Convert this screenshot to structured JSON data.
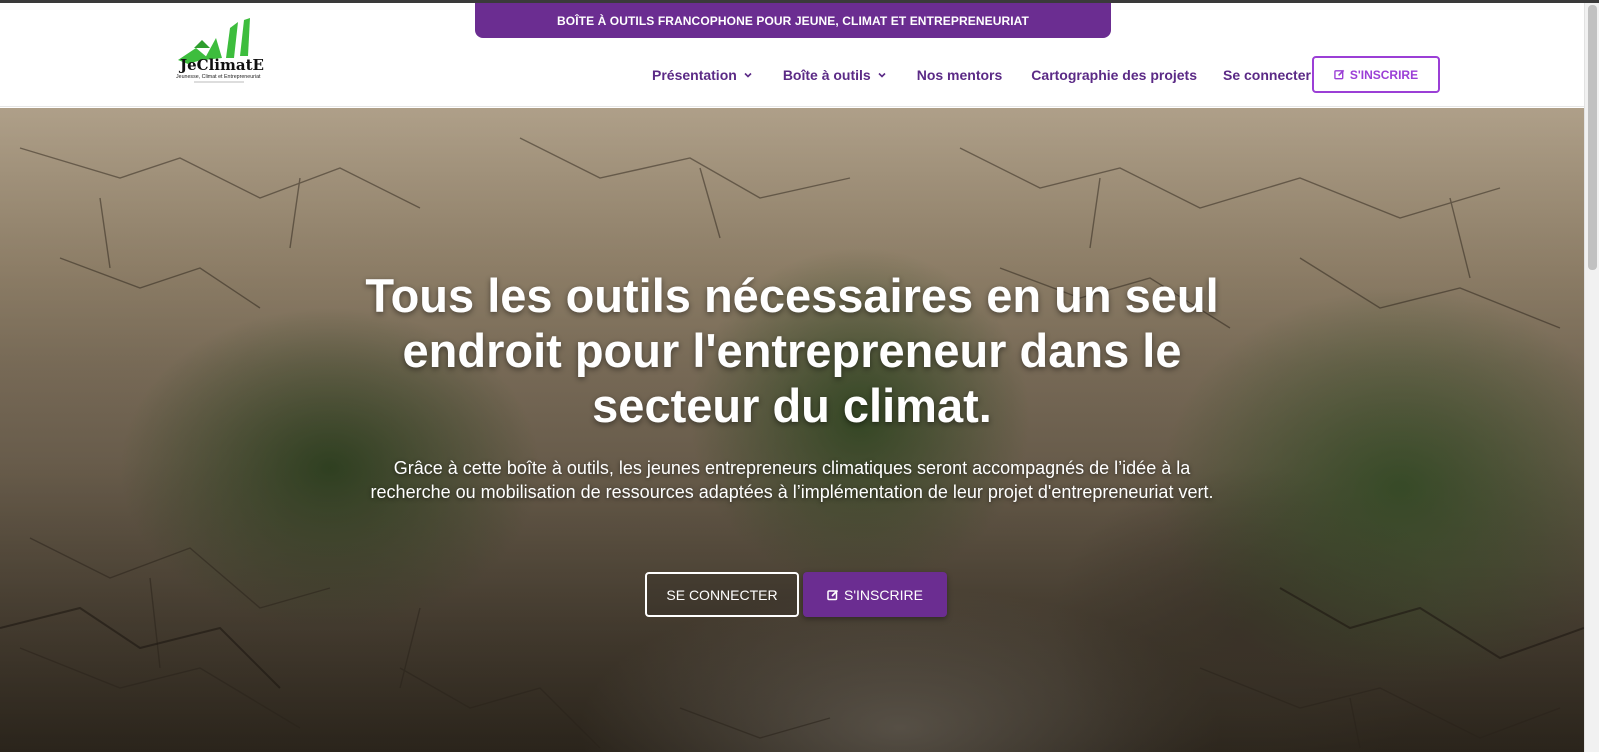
{
  "header": {
    "banner_text": "BOÎTE À OUTILS FRANCOPHONE POUR JEUNE, CLIMAT ET ENTREPRENEURIAT",
    "logo": {
      "name": "JeClimatE",
      "tagline": "Jeunesse, Climat et Entrepreneuriat"
    },
    "nav": [
      {
        "label": "Présentation",
        "has_dropdown": true
      },
      {
        "label": "Boîte à outils",
        "has_dropdown": true
      },
      {
        "label": "Nos mentors",
        "has_dropdown": false
      },
      {
        "label": "Cartographie des projets",
        "has_dropdown": false
      },
      {
        "label": "Se connecter",
        "has_dropdown": false
      }
    ],
    "signup_label": "S'INSCRIRE"
  },
  "hero": {
    "title": "Tous les outils nécessaires en un seul endroit pour l'entrepreneur dans le secteur du climat.",
    "subtitle": "Grâce à cette boîte à outils, les jeunes entrepreneurs climatiques seront accompagnés de l’idée à la recherche ou mobilisation de ressources adaptées à l’implémentation de leur projet d'entrepreneuriat vert.",
    "login_label": "SE CONNECTER",
    "signup_label": "S'INSCRIRE"
  },
  "colors": {
    "brand_purple": "#6b2d91",
    "nav_text": "#5b2a86",
    "signup_outline": "#9b3fd6",
    "logo_green": "#3dbd3d"
  },
  "icons": {
    "dropdown": "chevron-down-icon",
    "signup": "edit-square-icon"
  }
}
